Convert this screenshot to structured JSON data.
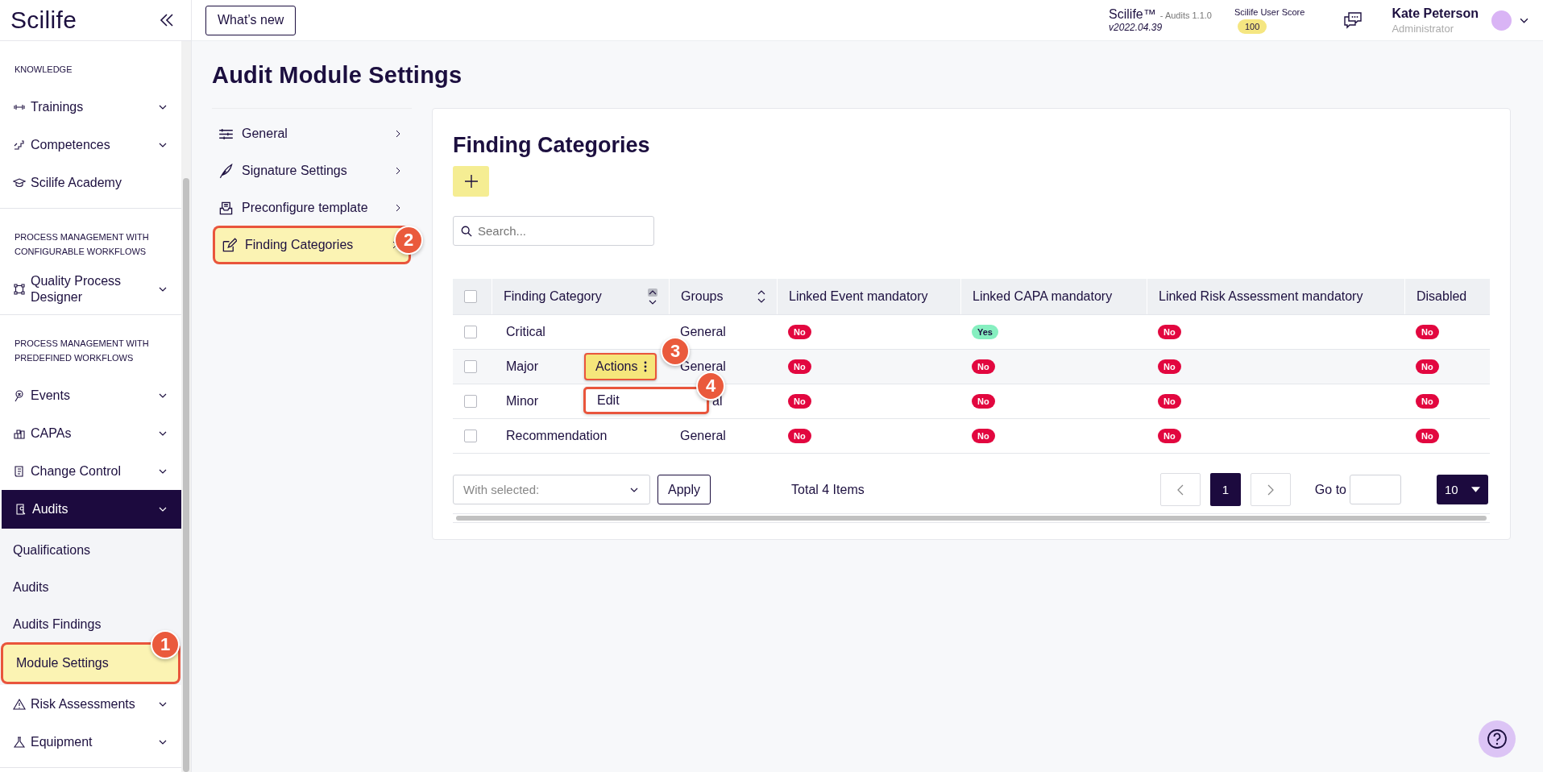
{
  "sidebar": {
    "logo": "Scilife",
    "sections": [
      {
        "heading": "KNOWLEDGE",
        "items": [
          {
            "label": "Trainings",
            "expandable": true,
            "selected": false
          },
          {
            "label": "Competences",
            "expandable": true,
            "selected": false
          },
          {
            "label": "Scilife Academy",
            "expandable": false,
            "selected": false
          }
        ]
      },
      {
        "heading": "PROCESS MANAGEMENT WITH CONFIGURABLE WORKFLOWS",
        "items": [
          {
            "label": "Quality Process Designer",
            "expandable": true,
            "selected": false
          }
        ]
      },
      {
        "heading": "PROCESS MANAGEMENT WITH PREDEFINED WORKFLOWS",
        "items": [
          {
            "label": "Events",
            "expandable": true,
            "selected": false
          },
          {
            "label": "CAPAs",
            "expandable": true,
            "selected": false
          },
          {
            "label": "Change Control",
            "expandable": true,
            "selected": false
          },
          {
            "label": "Audits",
            "expandable": true,
            "expanded": true,
            "selected": true,
            "children": [
              {
                "label": "Qualifications",
                "selected": false
              },
              {
                "label": "Audits",
                "selected": false
              },
              {
                "label": "Audits Findings",
                "selected": false
              },
              {
                "label": "Module Settings",
                "selected": true,
                "callout": "1"
              }
            ]
          },
          {
            "label": "Risk Assessments",
            "expandable": true,
            "selected": false
          },
          {
            "label": "Equipment",
            "expandable": true,
            "selected": false
          }
        ]
      }
    ]
  },
  "header": {
    "whats_new": "What’s new",
    "product": "Scilife™",
    "module": "- Audits 1.1.0",
    "version": "v2022.04.39",
    "score_label": "Scilife User Score",
    "score": "100",
    "user_name": "Kate Peterson",
    "user_role": "Administrator"
  },
  "page_title": "Audit Module Settings",
  "settings_menu": [
    {
      "label": "General",
      "selected": false
    },
    {
      "label": "Signature Settings",
      "selected": false
    },
    {
      "label": "Preconfigure template",
      "selected": false
    },
    {
      "label": "Finding Categories",
      "selected": true,
      "callout": "2"
    }
  ],
  "card": {
    "title": "Finding Categories",
    "search": {
      "placeholder": "Search..."
    }
  },
  "table": {
    "all_checked": false,
    "columns": [
      {
        "label": "Finding Category",
        "sortable": true,
        "sorted_ascending": true
      },
      {
        "label": "Groups",
        "sortable": true,
        "sorted_ascending": false
      },
      {
        "label": "Linked Event mandatory"
      },
      {
        "label": "Linked CAPA mandatory"
      },
      {
        "label": "Linked Risk Assessment mandatory"
      },
      {
        "label": "Disabled"
      }
    ],
    "rows": [
      {
        "name": "Critical",
        "group": "General",
        "checked": false,
        "flags": [
          {
            "text": "No",
            "positive": false
          },
          {
            "text": "Yes",
            "positive": true
          },
          {
            "text": "No",
            "positive": false
          },
          {
            "text": "No",
            "positive": false
          }
        ]
      },
      {
        "name": "Major",
        "group": "General",
        "checked": false,
        "actions": {
          "label": "Actions",
          "callout": "3"
        },
        "flags": [
          {
            "text": "No",
            "positive": false
          },
          {
            "text": "No",
            "positive": false
          },
          {
            "text": "No",
            "positive": false
          },
          {
            "text": "No",
            "positive": false
          }
        ]
      },
      {
        "name": "Minor",
        "group": "al",
        "checked": false,
        "menu": {
          "items": [
            {
              "label": "Edit"
            }
          ],
          "callout": "4"
        },
        "flags": [
          {
            "text": "No",
            "positive": false
          },
          {
            "text": "No",
            "positive": false
          },
          {
            "text": "No",
            "positive": false
          },
          {
            "text": "No",
            "positive": false
          }
        ]
      },
      {
        "name": "Recommendation",
        "group": "General",
        "checked": false,
        "flags": [
          {
            "text": "No",
            "positive": false
          },
          {
            "text": "No",
            "positive": false
          },
          {
            "text": "No",
            "positive": false
          },
          {
            "text": "No",
            "positive": false
          }
        ]
      }
    ]
  },
  "footer": {
    "bulk_placeholder": "With selected:",
    "apply": "Apply",
    "total": "Total 4 Items",
    "pages": [
      {
        "label": "1",
        "selected": true
      }
    ],
    "goto": "Go to",
    "page_size": "10"
  }
}
